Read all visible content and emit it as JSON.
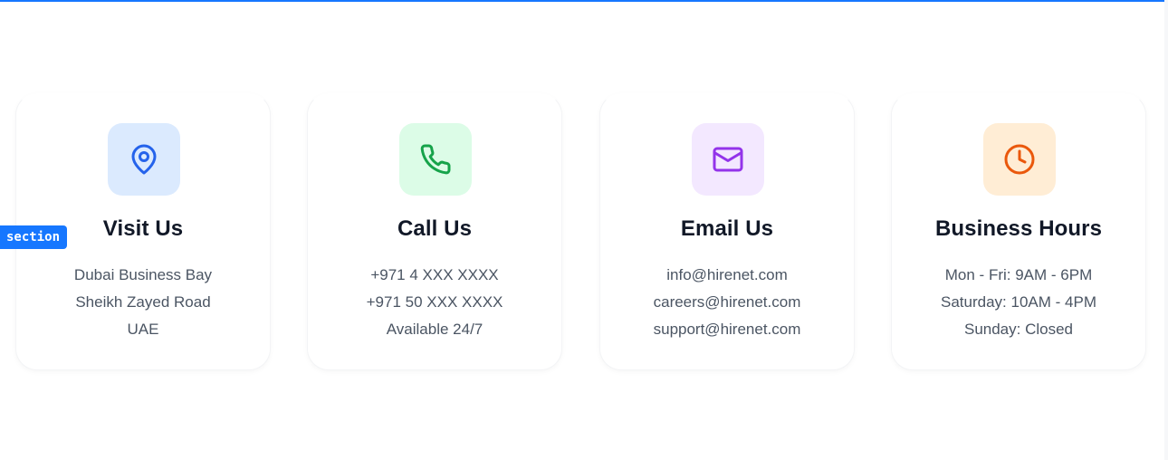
{
  "overlay": {
    "section_label": "section"
  },
  "colors": {
    "blue_tile": "#dbeafe",
    "blue_icon": "#2563eb",
    "green_tile": "#dcfce7",
    "green_icon": "#16a34a",
    "purple_tile": "#f3e8ff",
    "purple_icon": "#9333ea",
    "orange_tile": "#ffedd5",
    "orange_icon": "#ea580c"
  },
  "cards": [
    {
      "icon": "map-pin-icon",
      "title": "Visit Us",
      "lines": [
        "Dubai Business Bay",
        "Sheikh Zayed Road",
        "UAE"
      ]
    },
    {
      "icon": "phone-icon",
      "title": "Call Us",
      "lines": [
        "+971 4 XXX XXXX",
        "+971 50 XXX XXXX",
        "Available 24/7"
      ]
    },
    {
      "icon": "mail-icon",
      "title": "Email Us",
      "lines": [
        "info@hirenet.com",
        "careers@hirenet.com",
        "support@hirenet.com"
      ]
    },
    {
      "icon": "clock-icon",
      "title": "Business Hours",
      "lines": [
        "Mon - Fri: 9AM - 6PM",
        "Saturday: 10AM - 4PM",
        "Sunday: Closed"
      ]
    }
  ]
}
